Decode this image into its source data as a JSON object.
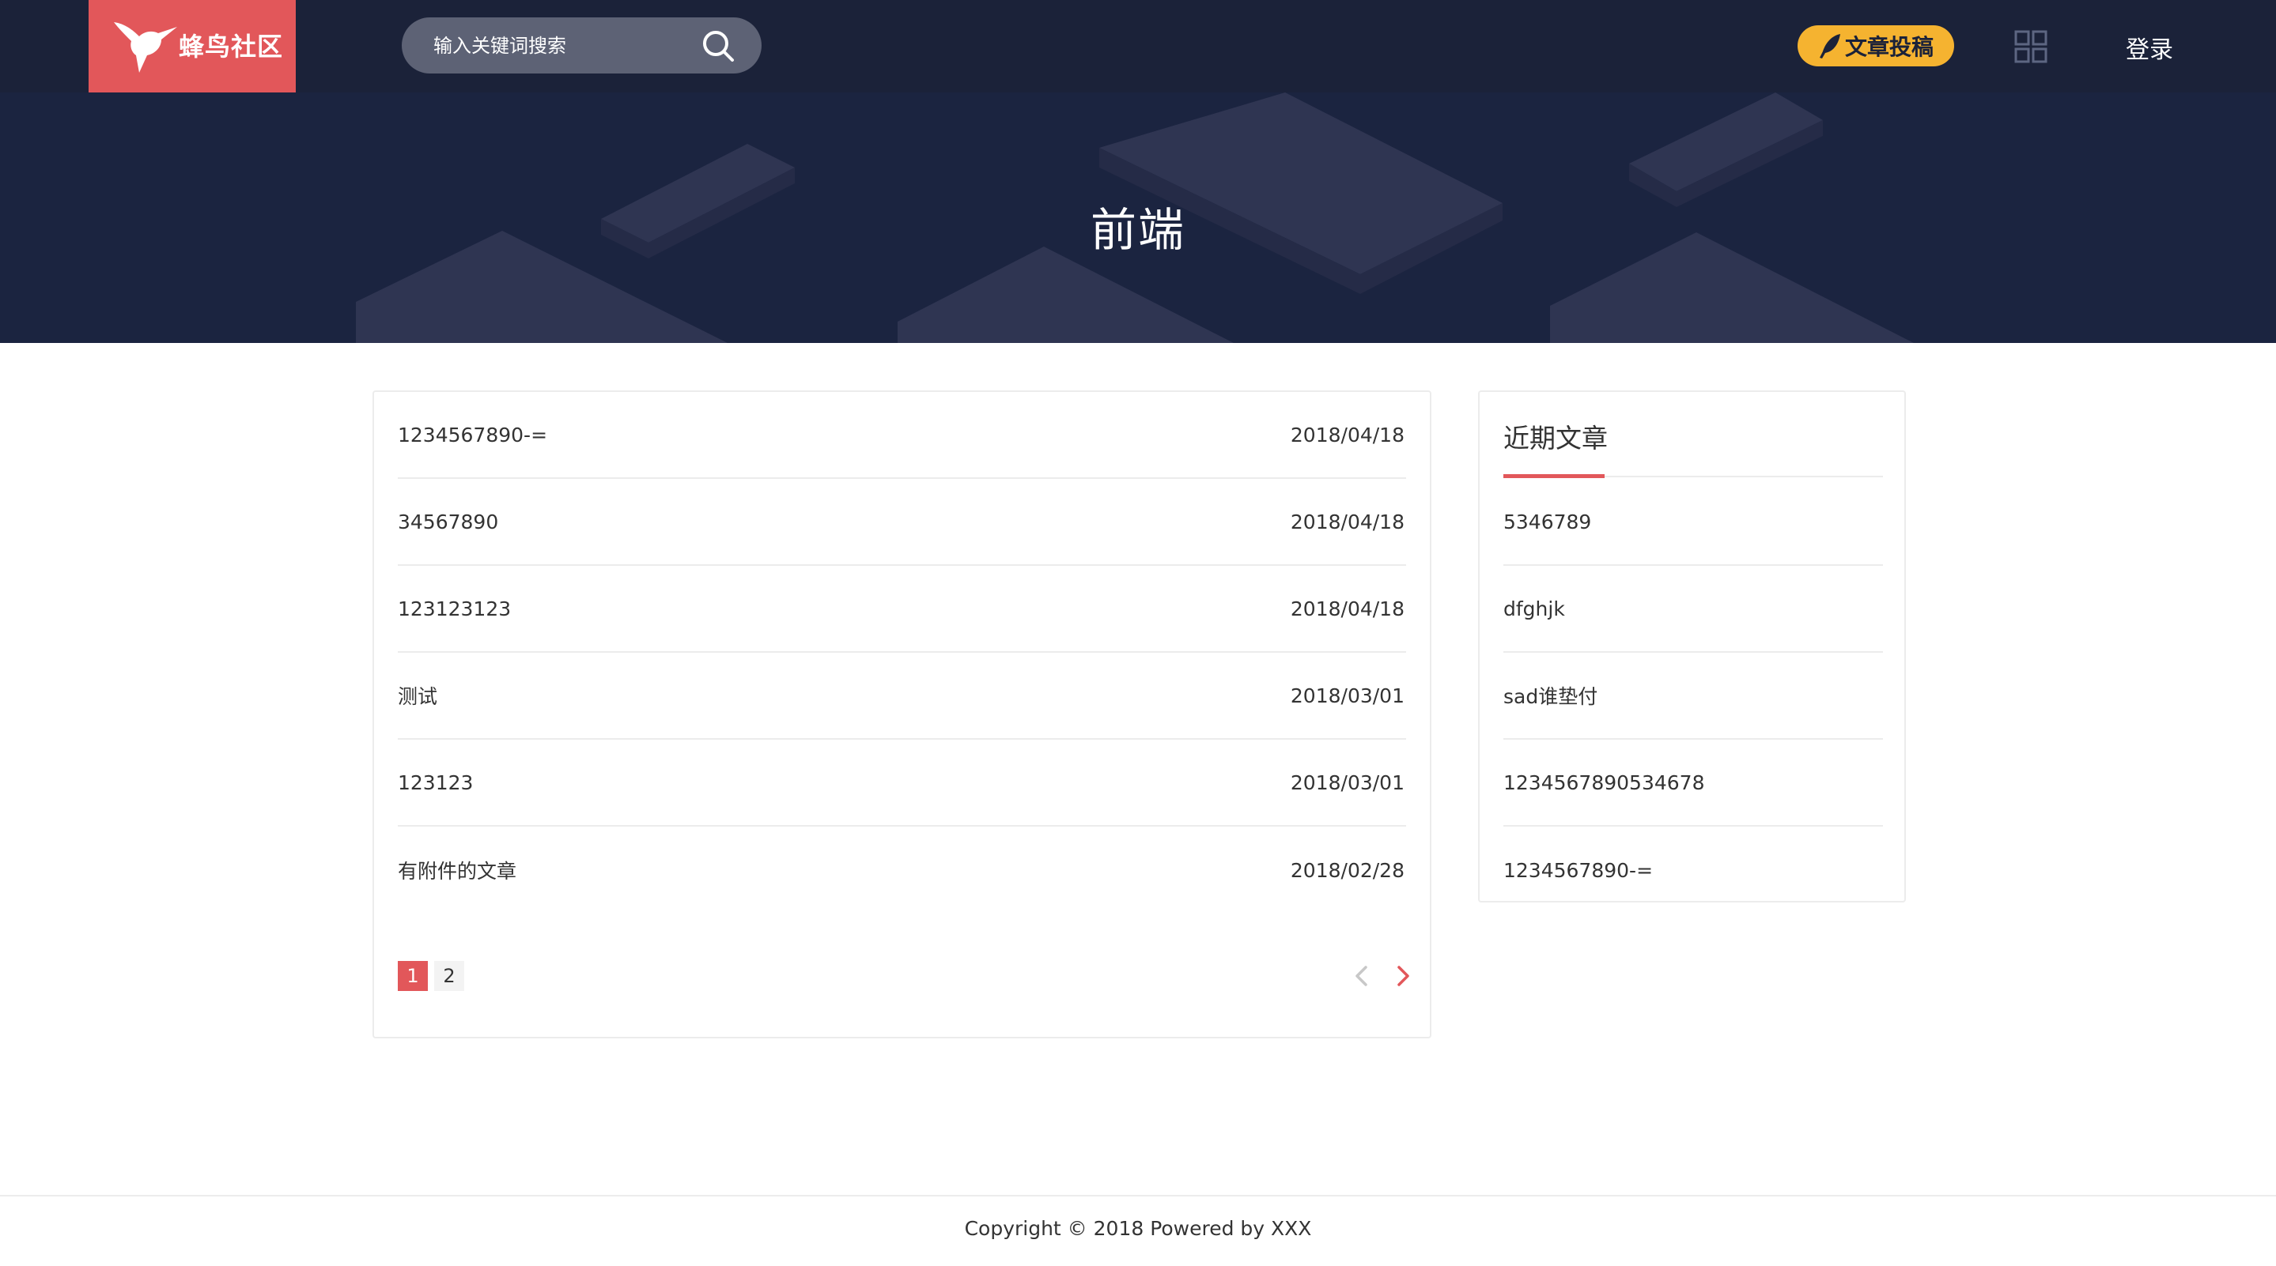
{
  "header": {
    "logo_text": "蜂鸟社区",
    "logo_icon": "hummingbird-icon",
    "search_placeholder": "输入关键词搜索",
    "search_icon": "search-icon",
    "contribute_label": "文章投稿",
    "contribute_icon": "quill-icon",
    "grid_icon": "grid-icon",
    "login_label": "登录"
  },
  "banner": {
    "title": "前端"
  },
  "articles": [
    {
      "title": "1234567890-=",
      "date": "2018/04/18"
    },
    {
      "title": "34567890",
      "date": "2018/04/18"
    },
    {
      "title": "123123123",
      "date": "2018/04/18"
    },
    {
      "title": "测试",
      "date": "2018/03/01"
    },
    {
      "title": "123123",
      "date": "2018/03/01"
    },
    {
      "title": "有附件的文章",
      "date": "2018/02/28"
    }
  ],
  "pagination": {
    "pages": [
      "1",
      "2"
    ],
    "current": "1",
    "prev_icon": "chevron-left-icon",
    "next_icon": "chevron-right-icon"
  },
  "recent": {
    "heading": "近期文章",
    "items": [
      "5346789",
      "dfghjk",
      "sad谁垫付",
      "1234567890534678",
      "1234567890-="
    ]
  },
  "footer": {
    "text": "Copyright © 2018 Powered by XXX"
  },
  "colors": {
    "header_bg": "#1b2239",
    "brand_red": "#e2575a",
    "contribute_yellow": "#f5b330",
    "search_bg": "#5d6275"
  }
}
